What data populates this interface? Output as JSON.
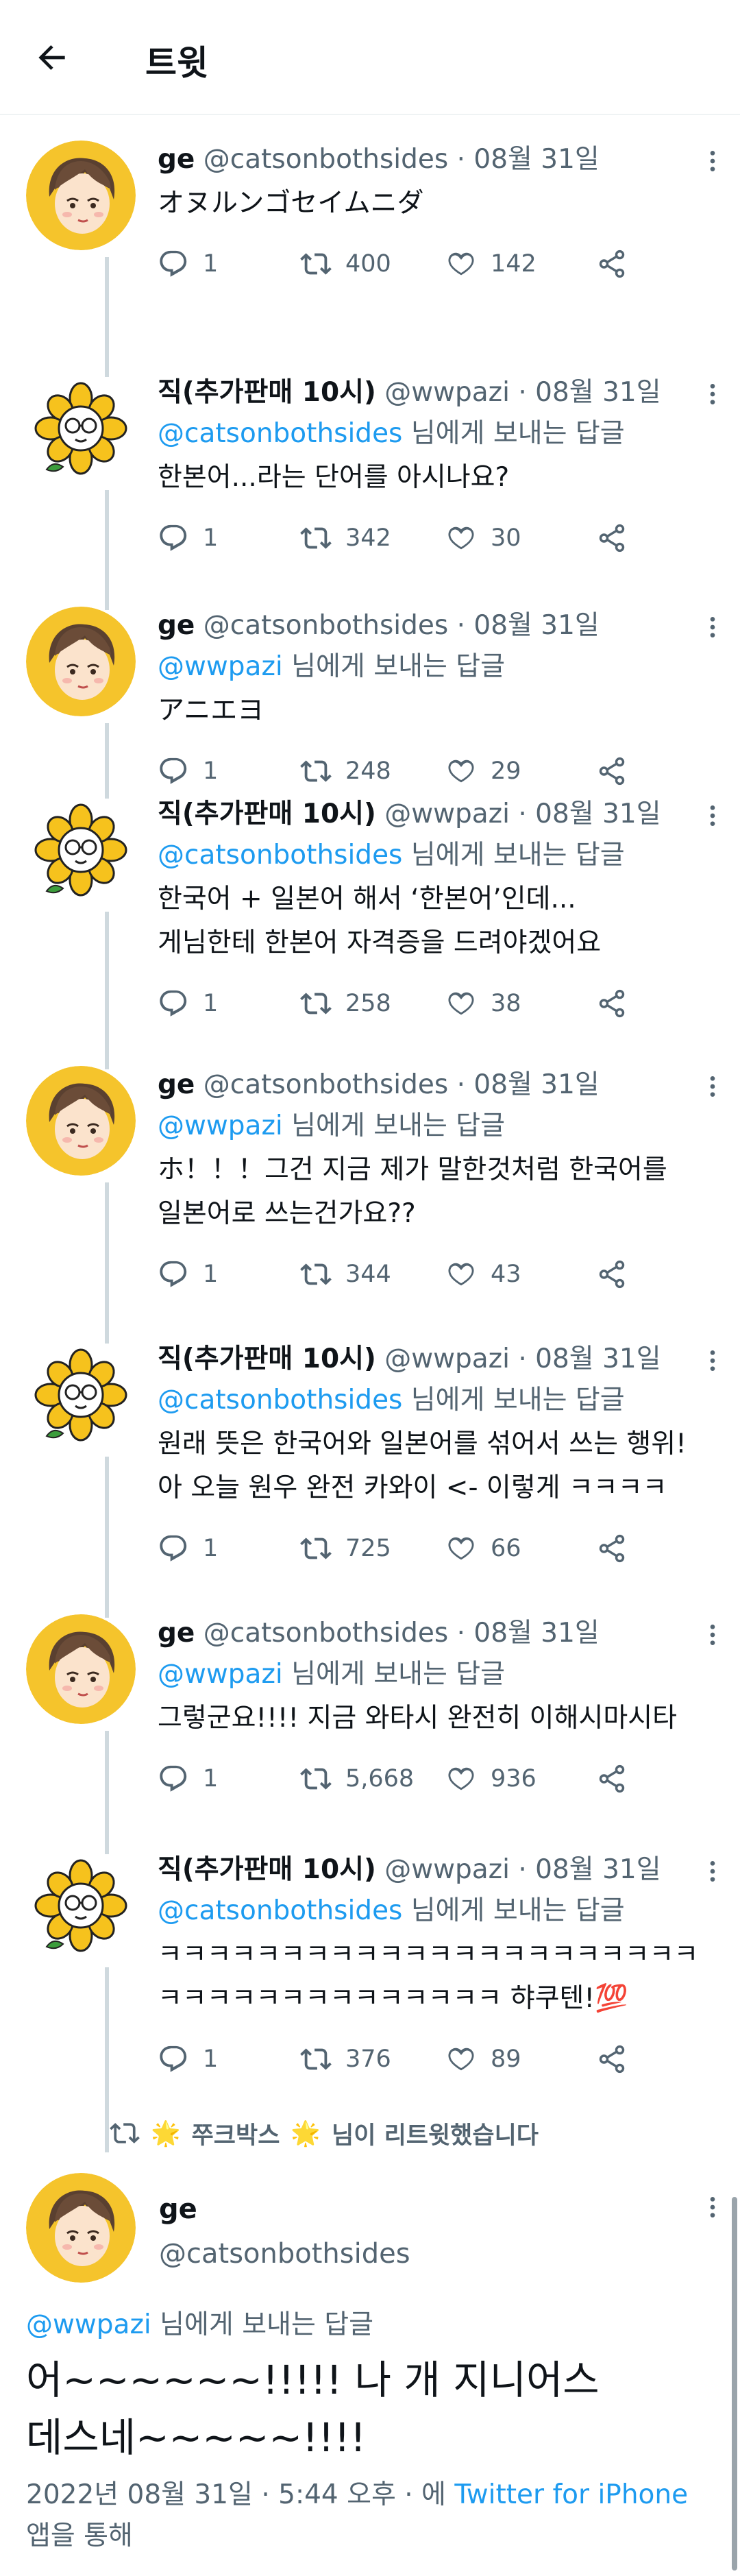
{
  "header": {
    "title": "트윗"
  },
  "icons": {
    "back": "arrow-left-icon",
    "more": "more-vertical-icon",
    "reply": "reply-bubble-icon",
    "retweet": "retweet-icon",
    "like": "heart-icon",
    "share": "share-icon"
  },
  "colors": {
    "accent": "#1d9bf0",
    "muted": "#536471",
    "text": "#0f1419",
    "thread": "#cfd9de"
  },
  "thread": [
    {
      "name": "ge",
      "handle": "@catsonbothsides",
      "sep": "·",
      "date": "08월 31일",
      "reply_prefix": "",
      "reply_to": "",
      "reply_suffix": "",
      "body": "オヌルンゴセイムニダ",
      "replies": "1",
      "retweets": "400",
      "likes": "142"
    },
    {
      "name": "직(추가판매 10시)",
      "handle": "@wwpazi",
      "sep": "·",
      "date": "08월 31일",
      "reply_to": "@catsonbothsides",
      "reply_suffix": "님에게 보내는 답글",
      "body": "한본어...라는 단어를 아시나요?",
      "replies": "1",
      "retweets": "342",
      "likes": "30"
    },
    {
      "name": "ge",
      "handle": "@catsonbothsides",
      "sep": "·",
      "date": "08월 31일",
      "reply_to": "@wwpazi",
      "reply_suffix": "님에게 보내는 답글",
      "body": "アニエヨ",
      "replies": "1",
      "retweets": "248",
      "likes": "29"
    },
    {
      "name": "직(추가판매 10시)",
      "handle": "@wwpazi",
      "sep": "·",
      "date": "08월 31일",
      "reply_to": "@catsonbothsides",
      "reply_suffix": "님에게 보내는 답글",
      "body": "한국어 + 일본어 해서 ‘한본어’인데...\n게님한테 한본어 자격증을 드려야겠어요",
      "replies": "1",
      "retweets": "258",
      "likes": "38"
    },
    {
      "name": "ge",
      "handle": "@catsonbothsides",
      "sep": "·",
      "date": "08월 31일",
      "reply_to": "@wwpazi",
      "reply_suffix": "님에게 보내는 답글",
      "body": "ホ！！！그건 지금 제가 말한것처럼 한국어를\n일본어로 쓰는건가요??",
      "replies": "1",
      "retweets": "344",
      "likes": "43"
    },
    {
      "name": "직(추가판매 10시)",
      "handle": "@wwpazi",
      "sep": "·",
      "date": "08월 31일",
      "reply_to": "@catsonbothsides",
      "reply_suffix": "님에게 보내는 답글",
      "body": "원래 뜻은 한국어와 일본어를 섞어서 쓰는 행위!\n아 오늘 원우 완전 카와이 <- 이렇게 ㅋㅋㅋㅋ",
      "replies": "1",
      "retweets": "725",
      "likes": "66"
    },
    {
      "name": "ge",
      "handle": "@catsonbothsides",
      "sep": "·",
      "date": "08월 31일",
      "reply_to": "@wwpazi",
      "reply_suffix": "님에게 보내는 답글",
      "body": "그렇군요!!!!  지금 와타시 완전히 이해시마시타",
      "replies": "1",
      "retweets": "5,668",
      "likes": "936"
    },
    {
      "name": "직(추가판매 10시)",
      "handle": "@wwpazi",
      "sep": "·",
      "date": "08월 31일",
      "reply_to": "@catsonbothsides",
      "reply_suffix": "님에게 보내는 답글",
      "body": "ㅋㅋㅋㅋㅋㅋㅋㅋㅋㅋㅋㅋㅋㅋㅋㅋㅋㅋㅋㅋㅋㅋ\nㅋㅋㅋㅋㅋㅋㅋㅋㅋㅋㅋㅋㅋㅋ 햐쿠텐!💯",
      "replies": "1",
      "retweets": "376",
      "likes": "89"
    }
  ],
  "retweeted_by": {
    "star_left": "🌟",
    "name": "쭈크박스",
    "star_right": "🌟",
    "suffix": "님이 리트윗했습니다"
  },
  "main_tweet": {
    "name": "ge",
    "handle": "@catsonbothsides",
    "reply_to": "@wwpazi",
    "reply_suffix": "님에게 보내는 답글",
    "body": "어~~~~~~!!!!! 나 개 지니어스\n데스네~~~~~!!!!",
    "timestamp": "2022년 08월 31일 · 5:44 오후 · 에",
    "source": "Twitter for iPhone",
    "source_suffix": "앱을 통해"
  }
}
